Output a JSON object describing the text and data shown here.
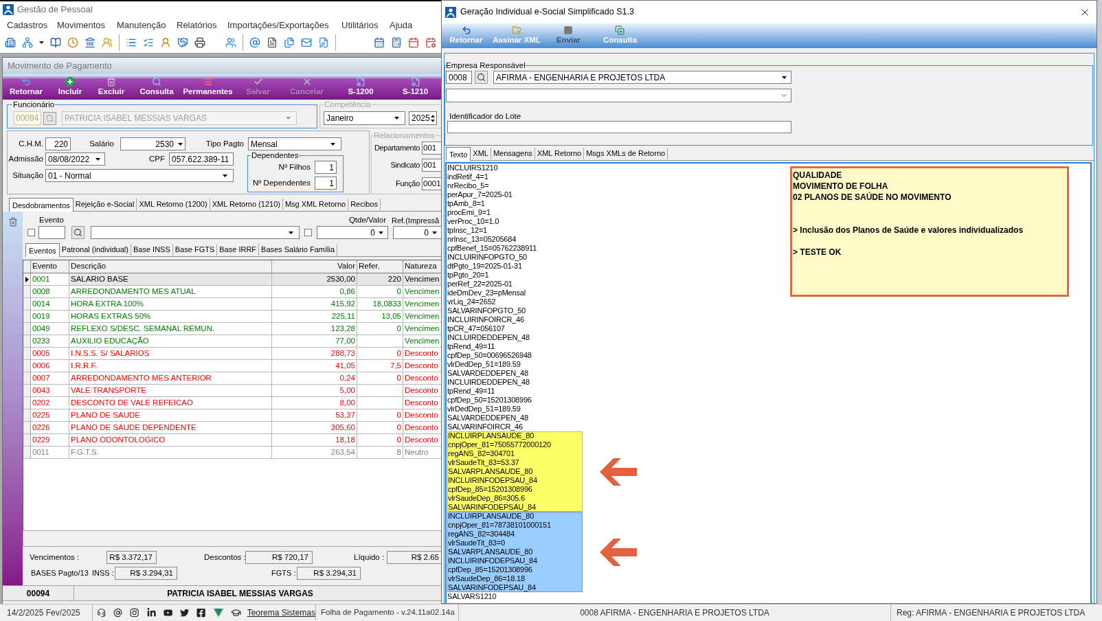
{
  "app": {
    "title": "Gestão de Pessoal",
    "menu": [
      "Cadastros",
      "Movimentos",
      "Manutenção",
      "Relatórios",
      "Importações/Exportações",
      "Utilitários",
      "Ajuda"
    ]
  },
  "payment_window": {
    "title": "Movimento de Pagamento",
    "toolbar": [
      {
        "label": "Retornar",
        "disabled": false
      },
      {
        "label": "Incluir",
        "disabled": false
      },
      {
        "label": "Excluir",
        "disabled": false
      },
      {
        "label": "Consulta",
        "disabled": false
      },
      {
        "label": "Permanentes",
        "disabled": false
      },
      {
        "label": "Salvar",
        "disabled": true
      },
      {
        "label": "Cancelar",
        "disabled": true
      },
      {
        "label": "S-1200",
        "disabled": false
      },
      {
        "label": "S-1210",
        "disabled": false
      }
    ],
    "employee": {
      "legend": "Funcionário",
      "code": "00094",
      "name": "PATRICIA ISABEL MESSIAS VARGAS",
      "disabled": true
    },
    "period": {
      "legend": "Competência",
      "month": "Janeiro",
      "year": "2025"
    },
    "details": {
      "chm": {
        "label": "C.H.M.",
        "value": "220"
      },
      "salary": {
        "label": "Salário",
        "value": "2530"
      },
      "payment_type": {
        "label": "Tipo Pagto",
        "value": "Mensal"
      },
      "admission": {
        "label": "Admissão",
        "value": "08/08/2022"
      },
      "cpf": {
        "label": "CPF",
        "value": "057.622.389-11"
      },
      "status": {
        "label": "Situação",
        "value": "01 - Normal"
      }
    },
    "dependents": {
      "legend": "Dependentes",
      "fields": [
        {
          "label": "Nº Filhos",
          "value": "1"
        },
        {
          "label": "Nº Dependentes",
          "value": "1"
        }
      ]
    },
    "relations": {
      "legend": "Relacionamentos",
      "fields": [
        {
          "label": "Departamento",
          "value": "001"
        },
        {
          "label": "Sindicato",
          "value": "001"
        },
        {
          "label": "Função",
          "value": "0001"
        }
      ]
    },
    "tabs": [
      {
        "label": "Desdobramentos",
        "selected": true
      },
      {
        "label": "Rejeição e-Social",
        "selected": false
      },
      {
        "label": "XML Retorno (1200)",
        "selected": false
      },
      {
        "label": "XML Retorno (1210)",
        "selected": false
      },
      {
        "label": "Msg XML Retorno",
        "selected": false
      },
      {
        "label": "Recibos",
        "selected": false
      }
    ],
    "event_filter": {
      "event_label": "Evento",
      "event_checked": false,
      "qty_label": "Qtde/Valor",
      "qty_checked": false,
      "qty_value": "0",
      "ref_label": "Ref.(Impressã",
      "ref_value": "0"
    },
    "subtabs": [
      {
        "label": "Eventos",
        "selected": true
      },
      {
        "label": "Patronal (individual)",
        "selected": false
      },
      {
        "label": "Base INSS",
        "selected": false
      },
      {
        "label": "Base FGTS",
        "selected": false
      },
      {
        "label": "Base IRRF",
        "selected": false
      },
      {
        "label": "Bases Salário Família",
        "selected": false
      }
    ],
    "grid": {
      "columns": [
        "Evento",
        "Descrição",
        "Valor",
        "Refer.",
        "Natureza"
      ],
      "rows": [
        {
          "evento": "0001",
          "descricao": "SALARIO BASE",
          "valor": "2530,00",
          "refer": "220",
          "natureza": "Vencimen",
          "color": "#008000",
          "selected": true
        },
        {
          "evento": "0008",
          "descricao": "ARREDONDAMENTO MES ATUAL",
          "valor": "0,86",
          "refer": "0",
          "natureza": "Vencimen",
          "color": "#008000",
          "selected": false
        },
        {
          "evento": "0014",
          "descricao": "HORA EXTRA 100%",
          "valor": "415,92",
          "refer": "18,0833",
          "natureza": "Vencimen",
          "color": "#008000",
          "selected": false
        },
        {
          "evento": "0019",
          "descricao": "HORAS EXTRAS 50%",
          "valor": "225,11",
          "refer": "13,05",
          "natureza": "Vencimen",
          "color": "#008000",
          "selected": false
        },
        {
          "evento": "0049",
          "descricao": "REFLEXO S/DESC. SEMANAL REMUN.",
          "valor": "123,28",
          "refer": "0",
          "natureza": "Vencimen",
          "color": "#008000",
          "selected": false
        },
        {
          "evento": "0233",
          "descricao": "AUXILIO EDUCAÇÃO",
          "valor": "77,00",
          "natureza": "Vencimen",
          "color": "#008000",
          "selected": false
        },
        {
          "evento": "0005",
          "descricao": "I.N.S.S. S/ SALARIOS",
          "valor": "288,73",
          "refer": "0",
          "natureza": "Desconto",
          "color": "#ff0000",
          "selected": false
        },
        {
          "evento": "0006",
          "descricao": "I.R.R.F.",
          "valor": "41,05",
          "refer": "7,5",
          "natureza": "Desconto",
          "color": "#ff0000",
          "selected": false
        },
        {
          "evento": "0007",
          "descricao": "ARREDONDAMENTO MES ANTERIOR",
          "valor": "0,24",
          "refer": "0",
          "natureza": "Desconto",
          "color": "#ff0000",
          "selected": false
        },
        {
          "evento": "0043",
          "descricao": "VALE TRANSPORTE",
          "valor": "5,00",
          "natureza": "Desconto",
          "color": "#ff0000",
          "selected": false
        },
        {
          "evento": "0202",
          "descricao": "DESCONTO DE VALE REFEICAO",
          "valor": "8,00",
          "natureza": "Desconto",
          "color": "#ff0000",
          "selected": false
        },
        {
          "evento": "0225",
          "descricao": "PLANO DE SAUDE",
          "valor": "53,37",
          "refer": "0",
          "natureza": "Desconto",
          "color": "#ff0000",
          "selected": false
        },
        {
          "evento": "0226",
          "descricao": "PLANO DE SAUDE DEPENDENTE",
          "valor": "305,60",
          "refer": "0",
          "natureza": "Desconto",
          "color": "#ff0000",
          "selected": false
        },
        {
          "evento": "0229",
          "descricao": "PLANO ODONTOLOGICO",
          "valor": "18,18",
          "refer": "0",
          "natureza": "Desconto",
          "color": "#ff0000",
          "selected": false
        },
        {
          "evento": "0011",
          "descricao": "F.G.T.S.",
          "valor": "263,54",
          "refer": "8",
          "natureza": "Neutro",
          "color": "#808080",
          "selected": false
        }
      ]
    },
    "totals": {
      "vencimentos": {
        "label": "Vencimentos :",
        "value": "R$ 3.372,17"
      },
      "descontos": {
        "label": "Descontos :",
        "value": "R$ 720,17"
      },
      "liquido": {
        "label": "Líquido :",
        "value": "R$ 2.65"
      },
      "bases_label": "BASES Pagto/13",
      "inss": {
        "label": "INSS :",
        "value": "R$ 3.294,31"
      },
      "fgts": {
        "label": "FGTS :",
        "value": "R$ 3.294,31"
      }
    },
    "footer": {
      "code": "00094",
      "name": "PATRICIA ISABEL MESSIAS VARGAS"
    }
  },
  "dialog": {
    "title": "Geração Individual e-Social Simplificado S1.3",
    "toolbar": [
      {
        "label": "Retornar",
        "disabled": false
      },
      {
        "label": "Assinar XML",
        "disabled": false
      },
      {
        "label": "Enviar",
        "disabled": true
      },
      {
        "label": "Consulta",
        "disabled": false
      }
    ],
    "company": {
      "legend": "Empresa Responsável",
      "code": "0008",
      "name": "AFIRMA - ENGENHARIA E PROJETOS LTDA"
    },
    "batch_label": "Identificador do Lote",
    "tabs": [
      {
        "label": "Texto",
        "selected": true
      },
      {
        "label": "XML",
        "selected": false
      },
      {
        "label": "Mensagens",
        "selected": false
      },
      {
        "label": "XML Retorno",
        "selected": false
      },
      {
        "label": "Msgs XMLs de Retorno",
        "selected": false
      }
    ],
    "text_blocks": [
      {
        "kind": "plain",
        "lines": [
          "INCLUIRS1210",
          "indRetif_4=1",
          "nrRecibo_5=",
          "perApur_7=2025-01",
          "tpAmb_8=1",
          "procEmi_9=1",
          "verProc_10=1.0",
          "tpInsc_12=1",
          "nrInsc_13=05205684",
          "cpfBenef_15=05762238911",
          "INCLUIRINFOPGTO_50",
          "dtPgto_19=2025-01-31",
          "tpPgto_20=1",
          "perRef_22=2025-01",
          "ideDmDev_23=pMensal",
          "vrLiq_24=2652",
          "SALVARINFOPGTO_50",
          "INCLUIRINFOIRCR_46",
          "tpCR_47=056107",
          "INCLUIRDEDDEPEN_48",
          "tpRend_49=11",
          "cpfDep_50=00696526948",
          "vlrDedDep_51=189.59",
          "SALVARDEDDEPEN_48",
          "INCLUIRDEDDEPEN_48",
          "tpRend_49=11",
          "cpfDep_50=15201308996",
          "vlrDedDep_51=189.59",
          "SALVARDEDDEPEN_48",
          "SALVARINFOIRCR_46"
        ]
      },
      {
        "kind": "highlight",
        "color": "#ffff66",
        "lines": [
          "INCLUIRPLANSAUDE_80",
          "cnpjOper_81=75055772000120",
          "regANS_82=304701",
          "vlrSaudeTit_83=53.37",
          "SALVARPLANSAUDE_80",
          "INCLUIRINFODEPSAU_84",
          "cpfDep_85=15201308996",
          "vlrSaudeDep_86=305.6",
          "SALVARINFODEPSAU_84"
        ]
      },
      {
        "kind": "highlight",
        "color": "#99ccff",
        "lines": [
          "INCLUIRPLANSAUDE_80",
          "cnpjOper_81=78738101000151",
          "regANS_82=304484",
          "vlrSaudeTit_83=0",
          "SALVARPLANSAUDE_80",
          "INCLUIRINFODEPSAU_84",
          "cpfDep_85=15201308996",
          "vlrSaudeDep_86=18.18",
          "SALVARINFODEPSAU_84"
        ]
      },
      {
        "kind": "plain",
        "lines": [
          "SALVARS1210"
        ]
      }
    ],
    "note": {
      "heading_lines": [
        "QUALIDADE",
        "MOVIMENTO DE FOLHA",
        "02 PLANOS DE SAÚDE NO MOVIMENTO"
      ],
      "items": [
        "> Inclusão dos Planos de Saúde e valores individualizados",
        "> TESTE OK"
      ]
    }
  },
  "status_bar": {
    "date": "14/2/2025 Fev/2025",
    "link": "Teorema Sistemas",
    "version": "Folha de Pagamento - v.24.11a02.14a",
    "company": "0008 AFIRMA - ENGENHARIA E PROJETOS LTDA",
    "registration": "Reg: AFIRMA - ENGENHARIA E PROJETOS LTDA"
  }
}
